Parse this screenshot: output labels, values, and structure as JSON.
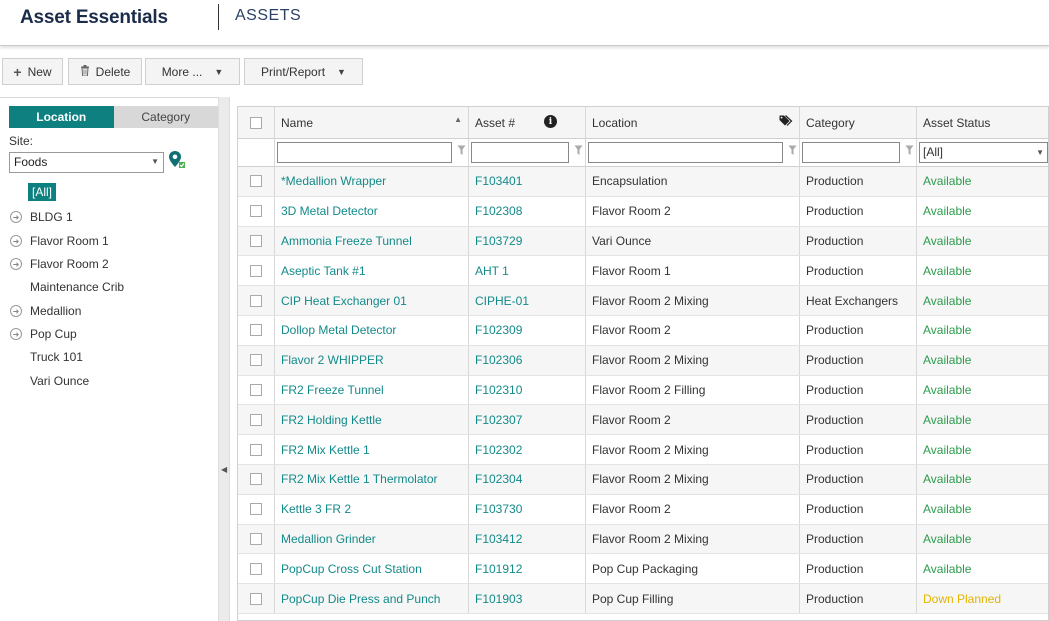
{
  "header": {
    "app_name": "Asset Essentials",
    "page_title": "ASSETS"
  },
  "toolbar": {
    "new_label": "New",
    "delete_label": "Delete",
    "more_label": "More ...",
    "print_label": "Print/Report"
  },
  "left_panel": {
    "tabs": [
      {
        "label": "Location",
        "active": true
      },
      {
        "label": "Category",
        "active": false
      }
    ],
    "site_label": "Site:",
    "site_value": "Foods",
    "tree": [
      {
        "label": "[All]",
        "expandable": false,
        "selected": true
      },
      {
        "label": "BLDG 1",
        "expandable": true
      },
      {
        "label": "Flavor Room 1",
        "expandable": true
      },
      {
        "label": "Flavor Room 2",
        "expandable": true
      },
      {
        "label": "Maintenance Crib",
        "expandable": false
      },
      {
        "label": "Medallion",
        "expandable": true
      },
      {
        "label": "Pop Cup",
        "expandable": true
      },
      {
        "label": "Truck 101",
        "expandable": false
      },
      {
        "label": "Vari Ounce",
        "expandable": false
      }
    ]
  },
  "grid": {
    "columns": [
      "Name",
      "Asset #",
      "Location",
      "Category",
      "Asset Status"
    ],
    "status_filter_value": "[All]",
    "status_colors": {
      "Available": "#2c9c4c",
      "Down Planned": "#e3b400"
    },
    "rows": [
      {
        "name": "*Medallion Wrapper",
        "asset": "F103401",
        "location": "Encapsulation",
        "category": "Production",
        "status": "Available"
      },
      {
        "name": "3D Metal Detector",
        "asset": "F102308",
        "location": "Flavor Room 2",
        "category": "Production",
        "status": "Available"
      },
      {
        "name": "Ammonia Freeze Tunnel",
        "asset": "F103729",
        "location": "Vari Ounce",
        "category": "Production",
        "status": "Available"
      },
      {
        "name": "Aseptic Tank #1",
        "asset": "AHT 1",
        "location": "Flavor Room 1",
        "category": "Production",
        "status": "Available"
      },
      {
        "name": "CIP Heat Exchanger 01",
        "asset": "CIPHE-01",
        "location": "Flavor Room 2 Mixing",
        "category": "Heat Exchangers",
        "status": "Available"
      },
      {
        "name": "Dollop Metal Detector",
        "asset": "F102309",
        "location": "Flavor Room 2",
        "category": "Production",
        "status": "Available"
      },
      {
        "name": "Flavor 2 WHIPPER",
        "asset": "F102306",
        "location": "Flavor Room 2 Mixing",
        "category": "Production",
        "status": "Available"
      },
      {
        "name": "FR2 Freeze Tunnel",
        "asset": "F102310",
        "location": "Flavor Room 2 Filling",
        "category": "Production",
        "status": "Available"
      },
      {
        "name": "FR2 Holding Kettle",
        "asset": "F102307",
        "location": "Flavor Room 2",
        "category": "Production",
        "status": "Available"
      },
      {
        "name": "FR2 Mix Kettle 1",
        "asset": "F102302",
        "location": "Flavor Room 2 Mixing",
        "category": "Production",
        "status": "Available"
      },
      {
        "name": "FR2 Mix Kettle 1 Thermolator",
        "asset": "F102304",
        "location": "Flavor Room 2 Mixing",
        "category": "Production",
        "status": "Available"
      },
      {
        "name": "Kettle 3 FR 2",
        "asset": "F103730",
        "location": "Flavor Room 2",
        "category": "Production",
        "status": "Available"
      },
      {
        "name": "Medallion Grinder",
        "asset": "F103412",
        "location": "Flavor Room 2 Mixing",
        "category": "Production",
        "status": "Available"
      },
      {
        "name": "PopCup Cross Cut Station",
        "asset": "F101912",
        "location": "Pop Cup Packaging",
        "category": "Production",
        "status": "Available"
      },
      {
        "name": "PopCup Die Press and Punch",
        "asset": "F101903",
        "location": "Pop Cup Filling",
        "category": "Production",
        "status": "Down Planned"
      }
    ]
  }
}
